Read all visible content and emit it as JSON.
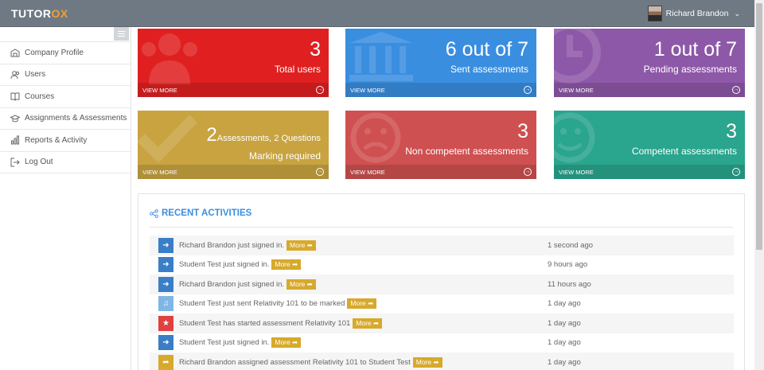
{
  "brand": {
    "name_main": "TUTOR",
    "name_accent": "OX"
  },
  "user": {
    "name": "Richard Brandon"
  },
  "sidebar": {
    "items": [
      {
        "label": "Company Profile",
        "icon": "building-icon"
      },
      {
        "label": "Users",
        "icon": "users-icon"
      },
      {
        "label": "Courses",
        "icon": "book-icon"
      },
      {
        "label": "Assignments & Assessments",
        "icon": "graduation-cap-icon"
      },
      {
        "label": "Reports & Activity",
        "icon": "bar-chart-icon"
      },
      {
        "label": "Log Out",
        "icon": "sign-out-icon"
      }
    ]
  },
  "tiles": [
    {
      "number": "3",
      "label": "Total users",
      "footer": "VIEW MORE",
      "color": "#e02020",
      "icon": "users-icon"
    },
    {
      "number": "6 out of 7",
      "label": "Sent assessments",
      "footer": "VIEW MORE",
      "color": "#3a8ee0",
      "icon": "institution-icon"
    },
    {
      "number": "1 out of 7",
      "label": "Pending assessments",
      "footer": "VIEW MORE",
      "color": "#8e58a8",
      "icon": "clock-icon"
    },
    {
      "number": "2",
      "number_suffix": "Assessments, 2 Questions",
      "label": "Marking required",
      "footer": "VIEW MORE",
      "color": "#c8a340",
      "icon": "check-icon"
    },
    {
      "number": "3",
      "label": "Non competent assessments",
      "footer": "VIEW MORE",
      "color": "#cf5050",
      "icon": "frown-icon"
    },
    {
      "number": "3",
      "label": "Competent assessments",
      "footer": "VIEW MORE",
      "color": "#2aa58e",
      "icon": "smile-icon"
    }
  ],
  "recent": {
    "title": "RECENT ACTIVITIES",
    "more_label": "More",
    "items": [
      {
        "text": "Richard Brandon just signed in.",
        "time": "1 second ago",
        "icon": "sign-in-icon"
      },
      {
        "text": "Student Test just signed in.",
        "time": "9 hours ago",
        "icon": "sign-in-icon"
      },
      {
        "text": "Richard Brandon just signed in.",
        "time": "11 hours ago",
        "icon": "sign-in-icon"
      },
      {
        "text": "Student Test just sent Relativity 101 to be marked",
        "time": "1 day ago",
        "icon": "bell-icon"
      },
      {
        "text": "Student Test has started assessment Relativity 101",
        "time": "1 day ago",
        "icon": "star-icon"
      },
      {
        "text": "Student Test just signed in.",
        "time": "1 day ago",
        "icon": "sign-in-icon"
      },
      {
        "text": "Richard Brandon assigned assessment Relativity 101 to Student Test",
        "time": "1 day ago",
        "icon": "share-icon"
      }
    ]
  }
}
